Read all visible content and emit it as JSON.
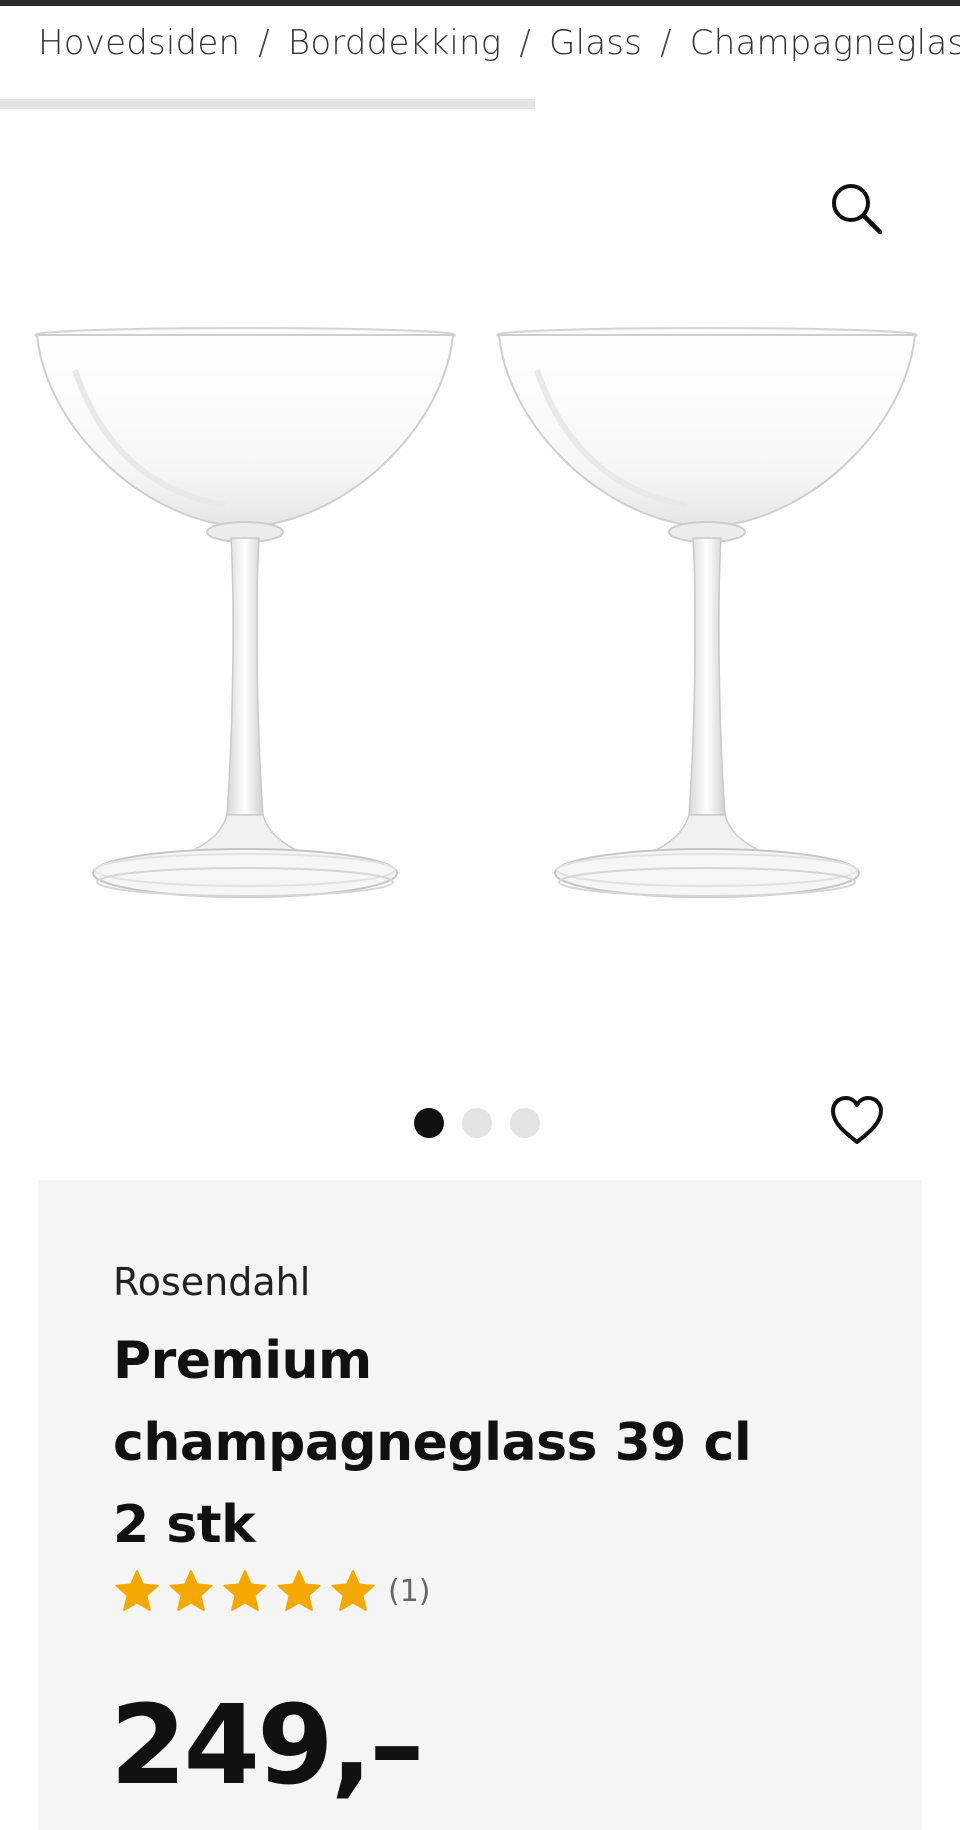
{
  "breadcrumb": {
    "items": [
      "Hovedsiden",
      "Borddekking",
      "Glass",
      "Champagneglass"
    ],
    "separator": "/"
  },
  "gallery": {
    "image_alt": "Premium champagneglass 39 cl 2 stk",
    "slide_count": 3,
    "active_slide": 1,
    "zoom_icon": "search-icon",
    "favorite_icon": "heart-icon"
  },
  "product": {
    "brand": "Rosendahl",
    "title": "Premium champagneglass 39 cl 2 stk",
    "rating": {
      "value": 5,
      "max": 5,
      "count_label": "(1)",
      "star_color": "#f5a800"
    },
    "price": "249,–"
  },
  "colors": {
    "card_background": "#f5f5f5",
    "active_dot": "#111111",
    "inactive_dot": "#e3e3e3"
  }
}
